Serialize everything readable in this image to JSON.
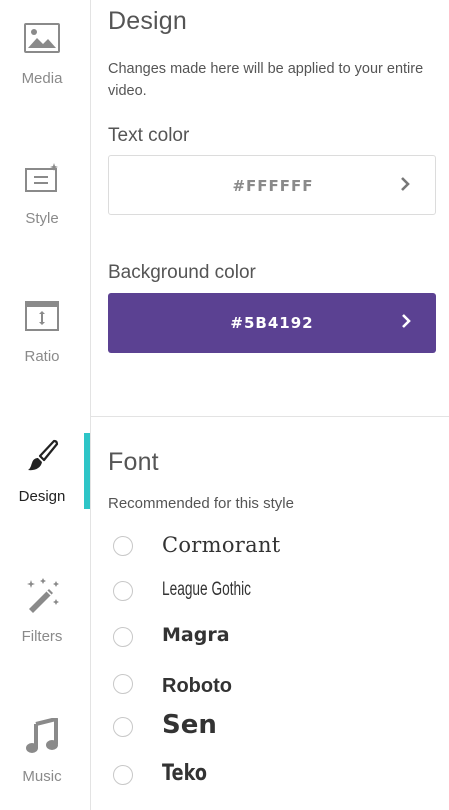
{
  "sidebar": {
    "items": [
      {
        "label": "Media",
        "icon": "image-icon"
      },
      {
        "label": "Style",
        "icon": "text-style-icon"
      },
      {
        "label": "Ratio",
        "icon": "aspect-ratio-icon"
      },
      {
        "label": "Design",
        "icon": "paintbrush-icon",
        "active": true
      },
      {
        "label": "Filters",
        "icon": "magic-wand-icon"
      },
      {
        "label": "Music",
        "icon": "music-note-icon"
      }
    ],
    "active_color": "#2EC5C7"
  },
  "design": {
    "title": "Design",
    "description": "Changes made here will be applied to your entire video.",
    "text_color": {
      "label": "Text color",
      "value": "#FFFFFF"
    },
    "background_color": {
      "label": "Background color",
      "value": "#5B4192",
      "swatch": "#5B4192"
    }
  },
  "font": {
    "title": "Font",
    "subtitle": "Recommended for this style",
    "options": [
      {
        "name": "Cormorant"
      },
      {
        "name": "League Gothic"
      },
      {
        "name": "Magra"
      },
      {
        "name": "Roboto"
      },
      {
        "name": "Sen"
      },
      {
        "name": "Teko"
      }
    ]
  }
}
